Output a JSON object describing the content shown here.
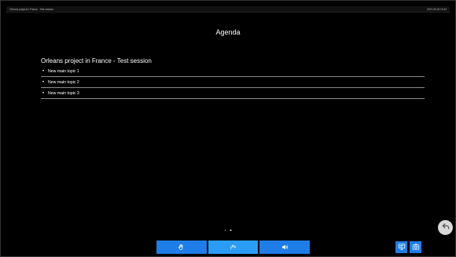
{
  "topbar": {
    "session_title": "Orleans project in France - Test session",
    "timestamp": "2023-09-05 15:25"
  },
  "page": {
    "title": "Agenda"
  },
  "agenda": {
    "project_title": "Orleans project in France - Test session",
    "topics": [
      {
        "label": "New main topic 1"
      },
      {
        "label": "New main topic 2"
      },
      {
        "label": "New main topic 3"
      }
    ]
  },
  "pager": {
    "count": 2,
    "active_index": 1
  },
  "toolbar": {
    "buttons": [
      {
        "icon": "hand-raise-icon"
      },
      {
        "icon": "voting-icon"
      },
      {
        "icon": "speaker-icon"
      }
    ]
  },
  "right_buttons": [
    {
      "icon": "screen-icon"
    },
    {
      "icon": "camera-icon"
    }
  ],
  "back_button": {
    "icon": "back-arrow-icon"
  },
  "colors": {
    "background": "#000000",
    "accent": "#1f7de8",
    "accent_active": "#2a9cf5",
    "divider": "#8a8a8a"
  }
}
